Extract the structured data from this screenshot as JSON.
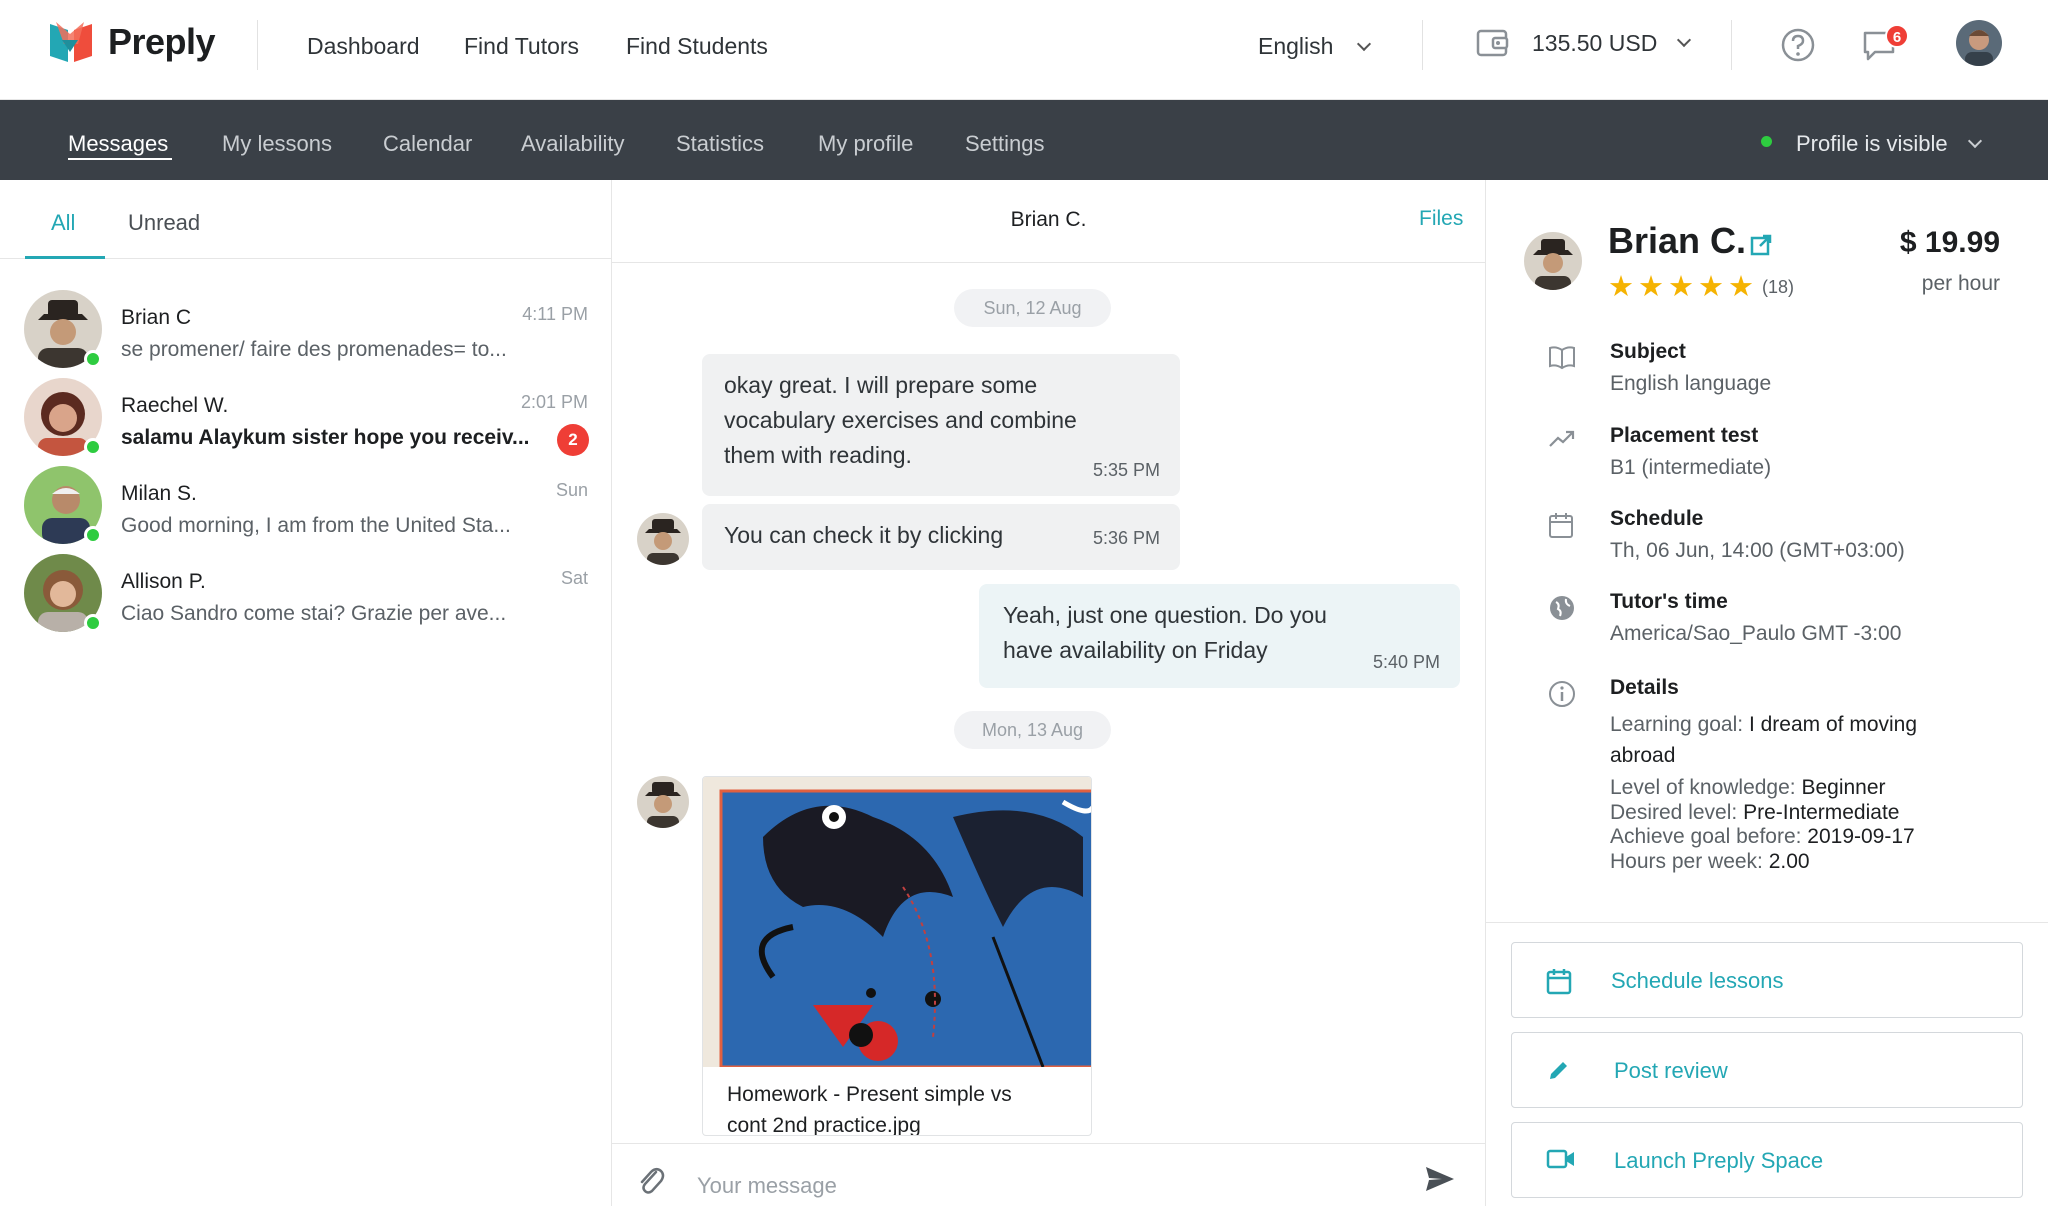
{
  "brand": {
    "name": "Preply",
    "accent": "#23a7b4",
    "danger": "#ef3e36",
    "online": "#2ecc40"
  },
  "topnav": {
    "items": [
      "Dashboard",
      "Find Tutors",
      "Find Students"
    ],
    "language": "English",
    "balance": "135.50 USD",
    "notifications_count": "6"
  },
  "subnav": {
    "items": [
      "Messages",
      "My lessons",
      "Calendar",
      "Availability",
      "Statistics",
      "My profile",
      "Settings"
    ],
    "active": "Messages",
    "visibility": "Profile is visible"
  },
  "inbox": {
    "tabs": {
      "all": "All",
      "unread": "Unread"
    },
    "conversations": [
      {
        "name": "Brian C",
        "time": "4:11 PM",
        "preview": "se promener/ faire des promenades= to...",
        "online": true
      },
      {
        "name": "Raechel W.",
        "time": "2:01 PM",
        "preview": "salamu Alaykum sister hope you receiv...",
        "online": true,
        "unread": "2"
      },
      {
        "name": "Milan S.",
        "time": "Sun",
        "preview": "Good morning, I am from the United Sta...",
        "online": true
      },
      {
        "name": "Allison P.",
        "time": "Sat",
        "preview": "Ciao Sandro come stai? Grazie per ave...",
        "online": true
      }
    ]
  },
  "chat": {
    "title": "Brian C.",
    "files_link": "Files",
    "dates": [
      "Sun, 12 Aug",
      "Mon,  13 Aug"
    ],
    "messages": [
      {
        "from": "tutor",
        "text_lines": [
          "okay great. I will prepare some",
          "vocabulary exercises and combine",
          "them with reading."
        ],
        "time": "5:35 PM"
      },
      {
        "from": "tutor",
        "text": "You can check it by clicking",
        "time": "5:36 PM"
      },
      {
        "from": "me",
        "text_lines": [
          "Yeah, just one question. Do you",
          "have availability on Friday"
        ],
        "time": "5:40 PM"
      }
    ],
    "attachment": {
      "name_lines": [
        "Homework - Present simple vs",
        "cont 2nd practice.jpg"
      ]
    },
    "composer_placeholder": "Your message"
  },
  "tutor": {
    "name": "Brian C.",
    "rating_stars": 5,
    "reviews": "(18)",
    "price": "$ 19.99",
    "per": "per hour",
    "subject": {
      "label": "Subject",
      "value": "English language"
    },
    "placement": {
      "label": "Placement test",
      "value": "B1 (intermediate)"
    },
    "schedule": {
      "label": "Schedule",
      "value": "Th, 06 Jun, 14:00 (GMT+03:00)"
    },
    "time": {
      "label": "Tutor's time",
      "value": "America/Sao_Paulo GMT -3:00"
    },
    "details": {
      "label": "Details",
      "goal_k": "Learning goal: ",
      "goal_v1": "I dream of moving",
      "goal_v2": "abroad",
      "level_k": "Level of knowledge: ",
      "level_v": "Beginner",
      "desired_k": "Desired level: ",
      "desired_v": "Pre-Intermediate",
      "before_k": "Achieve goal before: ",
      "before_v": "2019-09-17",
      "hours_k": "Hours per week: ",
      "hours_v": "2.00"
    },
    "actions": [
      "Schedule lessons",
      "Post review",
      "Launch Preply Space"
    ]
  }
}
